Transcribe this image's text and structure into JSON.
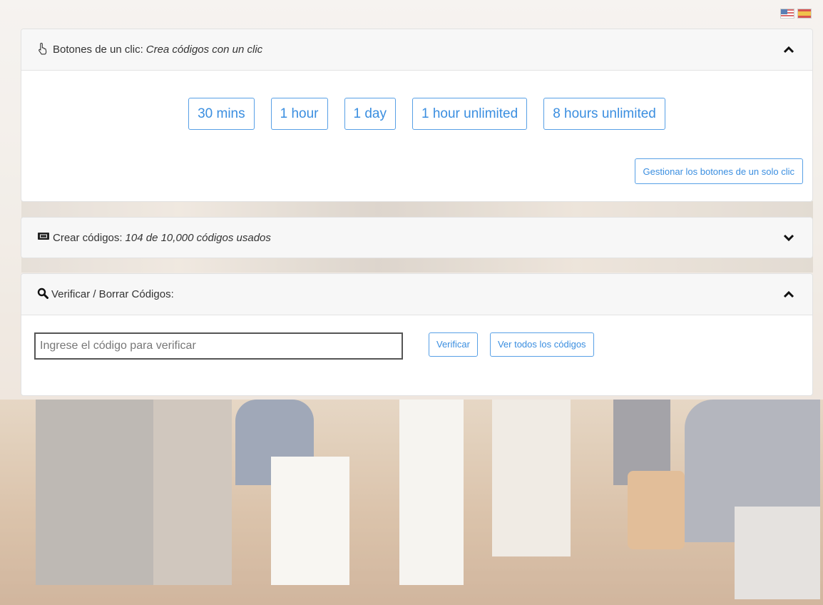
{
  "languages": [
    {
      "code": "en",
      "icon": "us-flag-icon"
    },
    {
      "code": "es",
      "icon": "spain-flag-icon"
    }
  ],
  "one_click": {
    "title": "Botones de un clic:",
    "subtitle": "Crea códigos con un clic",
    "icon": "pointer-hand-icon",
    "buttons": [
      "30 mins",
      "1 hour",
      "1 day",
      "1 hour unlimited",
      "8 hours unlimited"
    ],
    "manage_label": "Gestionar los botones de un solo clic",
    "collapse_icon": "chevron-up-icon"
  },
  "create_codes": {
    "title": "Crear códigos:",
    "subtitle": "104 de 10,000 códigos usados",
    "icon": "ticket-icon",
    "expand_icon": "chevron-down-icon"
  },
  "verify": {
    "title": "Verificar / Borrar Códigos:",
    "icon": "search-icon",
    "input_placeholder": "Ingrese el código para verificar",
    "input_value": "",
    "verify_label": "Verificar",
    "view_all_label": "Ver todos los códigos",
    "collapse_icon": "chevron-up-icon"
  },
  "colors": {
    "accent": "#3a8ee0",
    "panel_header": "#f7f7f7"
  }
}
